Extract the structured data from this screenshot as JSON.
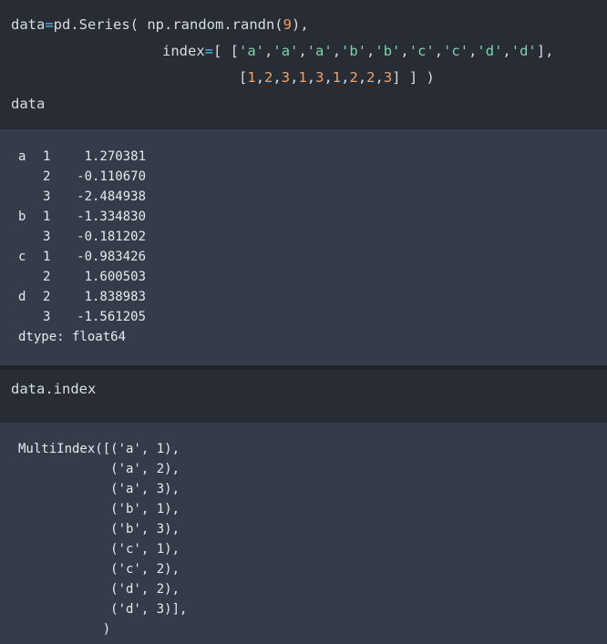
{
  "cell1": {
    "line1": {
      "name": "data",
      "op": "=",
      "call": "pd.Series(",
      "arg": " np.random.randn(",
      "num": "9",
      "close": "),"
    },
    "line2": {
      "prefix": "index",
      "op": "=",
      "open": "[ [",
      "strs": [
        "'a'",
        "'a'",
        "'a'",
        "'b'",
        "'b'",
        "'c'",
        "'c'",
        "'d'",
        "'d'"
      ],
      "close": "],"
    },
    "line3": {
      "open": "[",
      "nums": [
        "1",
        "2",
        "3",
        "1",
        "3",
        "1",
        "2",
        "2",
        "3"
      ],
      "close": "] ] )"
    },
    "line4": "data"
  },
  "output1": {
    "rows": [
      {
        "l0": "a",
        "l1": "1",
        "v": "1.270381"
      },
      {
        "l0": "",
        "l1": "2",
        "v": "-0.110670"
      },
      {
        "l0": "",
        "l1": "3",
        "v": "-2.484938"
      },
      {
        "l0": "b",
        "l1": "1",
        "v": "-1.334830"
      },
      {
        "l0": "",
        "l1": "3",
        "v": "-0.181202"
      },
      {
        "l0": "c",
        "l1": "1",
        "v": "-0.983426"
      },
      {
        "l0": "",
        "l1": "2",
        "v": "1.600503"
      },
      {
        "l0": "d",
        "l1": "2",
        "v": "1.838983"
      },
      {
        "l0": "",
        "l1": "3",
        "v": "-1.561205"
      }
    ],
    "dtype": "dtype: float64"
  },
  "cell2": {
    "code": "data.index"
  },
  "output2": {
    "lines": [
      "MultiIndex([('a', 1),",
      "            ('a', 2),",
      "            ('a', 3),",
      "            ('b', 1),",
      "            ('b', 3),",
      "            ('c', 1),",
      "            ('c', 2),",
      "            ('d', 2),",
      "            ('d', 3)],",
      "           )"
    ]
  },
  "colors": {
    "input_bg": "#272c35",
    "output_bg": "#353c49",
    "operator": "#4fc1e9",
    "number": "#f0a36b",
    "string": "#7fd4a9"
  }
}
